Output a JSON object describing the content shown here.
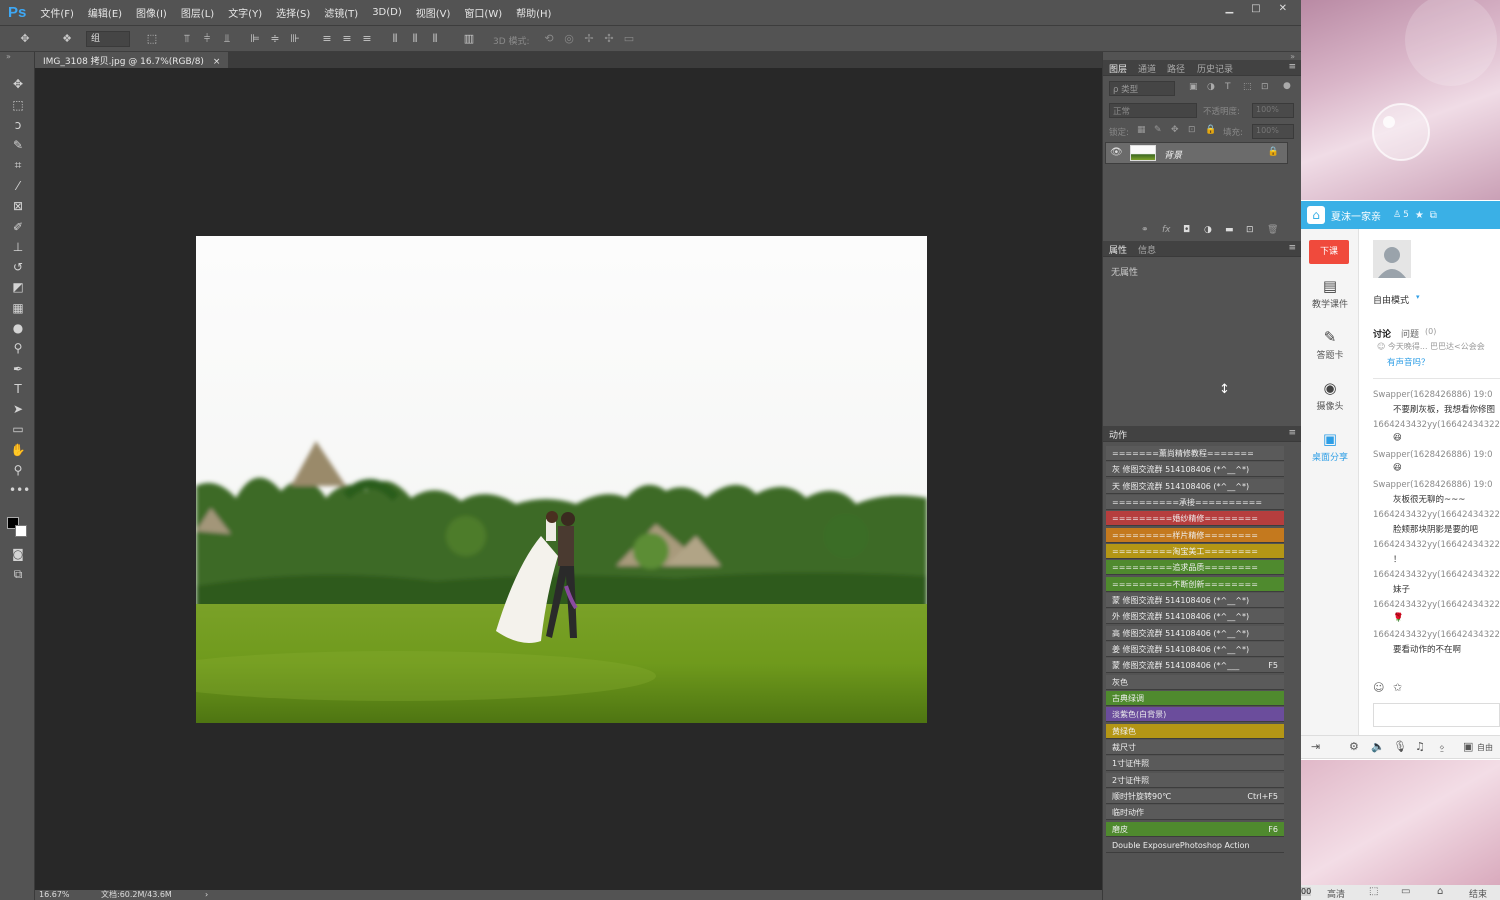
{
  "app": {
    "logo": "Ps"
  },
  "menu": [
    "文件(F)",
    "编辑(E)",
    "图像(I)",
    "图层(L)",
    "文字(Y)",
    "选择(S)",
    "滤镜(T)",
    "3D(D)",
    "视图(V)",
    "窗口(W)",
    "帮助(H)"
  ],
  "window_controls": [
    "▁",
    "□",
    "✕"
  ],
  "options": {
    "auto_select_value": "组",
    "mode_3d_label": "3D 模式:"
  },
  "document": {
    "tab_title": "IMG_3108 拷贝.jpg @ 16.7%(RGB/8)",
    "close": "×"
  },
  "status": {
    "zoom": "16.67%",
    "doc_size": "文档:60.2M/43.6M",
    "arrow": "›"
  },
  "layers_panel": {
    "tabs": [
      "图层",
      "通道",
      "路径",
      "历史记录"
    ],
    "filter_label": "ρ 类型",
    "blend_mode": "正常",
    "opacity_label": "不透明度:",
    "opacity_value": "100%",
    "lock_label": "锁定:",
    "fill_label": "填充:",
    "fill_value": "100%",
    "layer_name": "背景",
    "footer_icons": [
      "⚭",
      "fx",
      "◘",
      "◑",
      "▬",
      "⊡",
      "🗑"
    ]
  },
  "properties_panel": {
    "tabs": [
      "属性",
      "信息"
    ],
    "content": "无属性"
  },
  "actions_panel": {
    "title": "动作",
    "items": [
      {
        "label": "=======薰尚精修教程=======",
        "color": "#5a5a5a",
        "shortcut": ""
      },
      {
        "label": "灰 修图交流群 514108406 (*^__^*)",
        "color": "#5a5a5a",
        "shortcut": ""
      },
      {
        "label": "天 修图交流群 514108406 (*^__^*)",
        "color": "#5a5a5a",
        "shortcut": ""
      },
      {
        "label": "==========承接==========",
        "color": "#5a5a5a",
        "shortcut": ""
      },
      {
        "label": "=========婚纱精修========",
        "color": "#b63e3e",
        "shortcut": ""
      },
      {
        "label": "=========样片精修========",
        "color": "#c4791e",
        "shortcut": ""
      },
      {
        "label": "=========淘宝美工========",
        "color": "#b49615",
        "shortcut": ""
      },
      {
        "label": "=========追求品质========",
        "color": "#4f8a2e",
        "shortcut": ""
      },
      {
        "label": "=========不断创新========",
        "color": "#4f8a2e",
        "shortcut": ""
      },
      {
        "label": "蒙 修图交流群 514108406 (*^__^*)",
        "color": "#5a5a5a",
        "shortcut": ""
      },
      {
        "label": "外 修图交流群 514108406 (*^__^*)",
        "color": "#5a5a5a",
        "shortcut": ""
      },
      {
        "label": "高 修图交流群 514108406 (*^__^*)",
        "color": "#5a5a5a",
        "shortcut": ""
      },
      {
        "label": "姜 修图交流群 514108406 (*^__^*)",
        "color": "#5a5a5a",
        "shortcut": ""
      },
      {
        "label": "蒙 修图交流群 514108406 (*^___",
        "color": "#5a5a5a",
        "shortcut": "F5"
      },
      {
        "label": "灰色",
        "color": "#5a5a5a",
        "shortcut": ""
      },
      {
        "label": "古典绿调",
        "color": "#4f8a2e",
        "shortcut": ""
      },
      {
        "label": "淡紫色(白背景)",
        "color": "#6b4d9c",
        "shortcut": ""
      },
      {
        "label": "黄绿色",
        "color": "#b49615",
        "shortcut": ""
      },
      {
        "label": "裁尺寸",
        "color": "#5a5a5a",
        "shortcut": ""
      },
      {
        "label": "1寸证件照",
        "color": "#5a5a5a",
        "shortcut": ""
      },
      {
        "label": "2寸证件照",
        "color": "#5a5a5a",
        "shortcut": ""
      },
      {
        "label": "顺时针旋转90℃",
        "color": "#5a5a5a",
        "shortcut": "Ctrl+F5"
      },
      {
        "label": "临时动作",
        "color": "#5a5a5a",
        "shortcut": ""
      },
      {
        "label": "磨皮",
        "color": "#4f8a2e",
        "shortcut": "F6"
      },
      {
        "label": "Double ExposurePhotoshop Action",
        "color": "#535353",
        "shortcut": ""
      }
    ]
  },
  "qq": {
    "group_name": "夏沫一家亲",
    "member_count": "5",
    "class_button": "下课",
    "nav": [
      {
        "label": "教学课件",
        "icon": "▤"
      },
      {
        "label": "答题卡",
        "icon": "✎"
      },
      {
        "label": "摄像头",
        "icon": "◉"
      },
      {
        "label": "桌面分享",
        "icon": "▣"
      }
    ],
    "mode": "自由模式",
    "tabs": {
      "discuss": "讨论",
      "question": "问题",
      "count": "(0)"
    },
    "notice": "☺ 今天晚得... 巴巴达<公会会",
    "notice_link": "有声音吗？",
    "messages": [
      {
        "name": "Swapper(1628426886) 19:0",
        "text": "不要刷灰板，我想看你修图"
      },
      {
        "name": "1664243432yy(16642434322",
        "text": "😆"
      },
      {
        "name": "Swapper(1628426886) 19:0",
        "text": "😆"
      },
      {
        "name": "Swapper(1628426886) 19:0",
        "text": "灰板很无聊的~~~"
      },
      {
        "name": "1664243432yy(16642434322",
        "text": "脸颊那块阴影是要的吧"
      },
      {
        "name": "1664243432yy(16642434322",
        "text": "！"
      },
      {
        "name": "1664243432yy(16642434322",
        "text": "妹子"
      },
      {
        "name": "1664243432yy(16642434322",
        "text": "🌹"
      },
      {
        "name": "1664243432yy(16642434322",
        "text": "要看动作的不在啊"
      }
    ],
    "toolbar_right": "自由",
    "footer": {
      "quality": "高清",
      "end": "结束",
      "left": "00"
    }
  }
}
